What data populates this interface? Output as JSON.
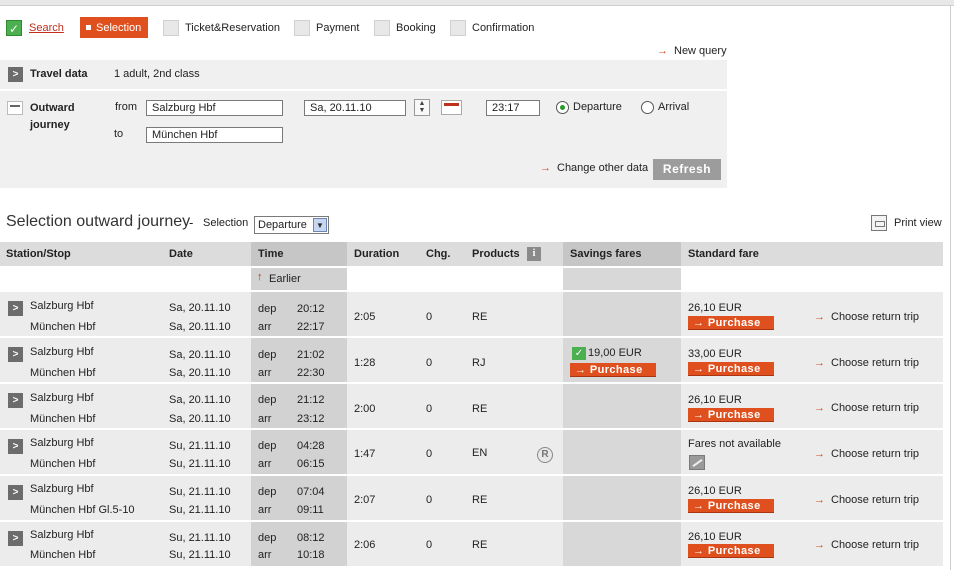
{
  "steps": {
    "search": "Search",
    "selection": "Selection",
    "ticket": "Ticket&Reservation",
    "payment": "Payment",
    "booking": "Booking",
    "confirmation": "Confirmation"
  },
  "new_query": "New query",
  "travel": {
    "label": "Travel data",
    "value": "1 adult, 2nd class"
  },
  "outward": {
    "label_line1": "Outward",
    "label_line2": "journey",
    "from_label": "from",
    "to_label": "to",
    "from_value": "Salzburg Hbf",
    "to_value": "München Hbf",
    "date_value": "Sa, 20.11.10",
    "time_value": "23:17",
    "departure_label": "Departure",
    "arrival_label": "Arrival",
    "selected_mode": "Departure"
  },
  "change_other_data": "Change other data",
  "refresh_label": "Refresh",
  "selection_header": {
    "title": "Selection outward journey",
    "dash": "-",
    "selection_label": "Selection",
    "selection_value": "Departure",
    "print_view": "Print view"
  },
  "table": {
    "columns": {
      "station": "Station/Stop",
      "date": "Date",
      "time": "Time",
      "duration": "Duration",
      "changes": "Chg.",
      "products": "Products",
      "savings": "Savings fares",
      "standard": "Standard fare"
    },
    "earlier": "Earlier",
    "purchase_label": "Purchase",
    "choose_return": "Choose return trip",
    "dep_label": "dep",
    "arr_label": "arr",
    "rows": [
      {
        "from": "Salzburg Hbf",
        "to": "München Hbf",
        "date_dep": "Sa, 20.11.10",
        "date_arr": "Sa, 20.11.10",
        "dep": "20:12",
        "arr": "22:17",
        "duration": "2:05",
        "changes": "0",
        "products": "RE",
        "savings": "",
        "standard": "26,10 EUR"
      },
      {
        "from": "Salzburg Hbf",
        "to": "München Hbf",
        "date_dep": "Sa, 20.11.10",
        "date_arr": "Sa, 20.11.10",
        "dep": "21:02",
        "arr": "22:30",
        "duration": "1:28",
        "changes": "0",
        "products": "RJ",
        "savings": "19,00 EUR",
        "standard": "33,00 EUR"
      },
      {
        "from": "Salzburg Hbf",
        "to": "München Hbf",
        "date_dep": "Sa, 20.11.10",
        "date_arr": "Sa, 20.11.10",
        "dep": "21:12",
        "arr": "23:12",
        "duration": "2:00",
        "changes": "0",
        "products": "RE",
        "savings": "",
        "standard": "26,10 EUR"
      },
      {
        "from": "Salzburg Hbf",
        "to": "München Hbf",
        "date_dep": "Su, 21.11.10",
        "date_arr": "Su, 21.11.10",
        "dep": "04:28",
        "arr": "06:15",
        "duration": "1:47",
        "changes": "0",
        "products": "EN",
        "savings": "",
        "standard": "Fares not available"
      },
      {
        "from": "Salzburg Hbf",
        "to": "München Hbf Gl.5-10",
        "date_dep": "Su, 21.11.10",
        "date_arr": "Su, 21.11.10",
        "dep": "07:04",
        "arr": "09:11",
        "duration": "2:07",
        "changes": "0",
        "products": "RE",
        "savings": "",
        "standard": "26,10 EUR"
      },
      {
        "from": "Salzburg Hbf",
        "to": "München Hbf",
        "date_dep": "Su, 21.11.10",
        "date_arr": "Su, 21.11.10",
        "dep": "08:12",
        "arr": "10:18",
        "duration": "2:06",
        "changes": "0",
        "products": "RE",
        "savings": "",
        "standard": "26,10 EUR"
      }
    ]
  },
  "icons": {
    "check": "checkmark-icon",
    "chevron": "chevron-right-icon",
    "arrow": "arrow-right-icon",
    "reservation": "reservation-r-icon",
    "info": "info-icon"
  },
  "colors": {
    "accent": "#e0501e",
    "link": "#c0301c",
    "panel": "#f0f0f0",
    "header": "#dcdcdc"
  }
}
